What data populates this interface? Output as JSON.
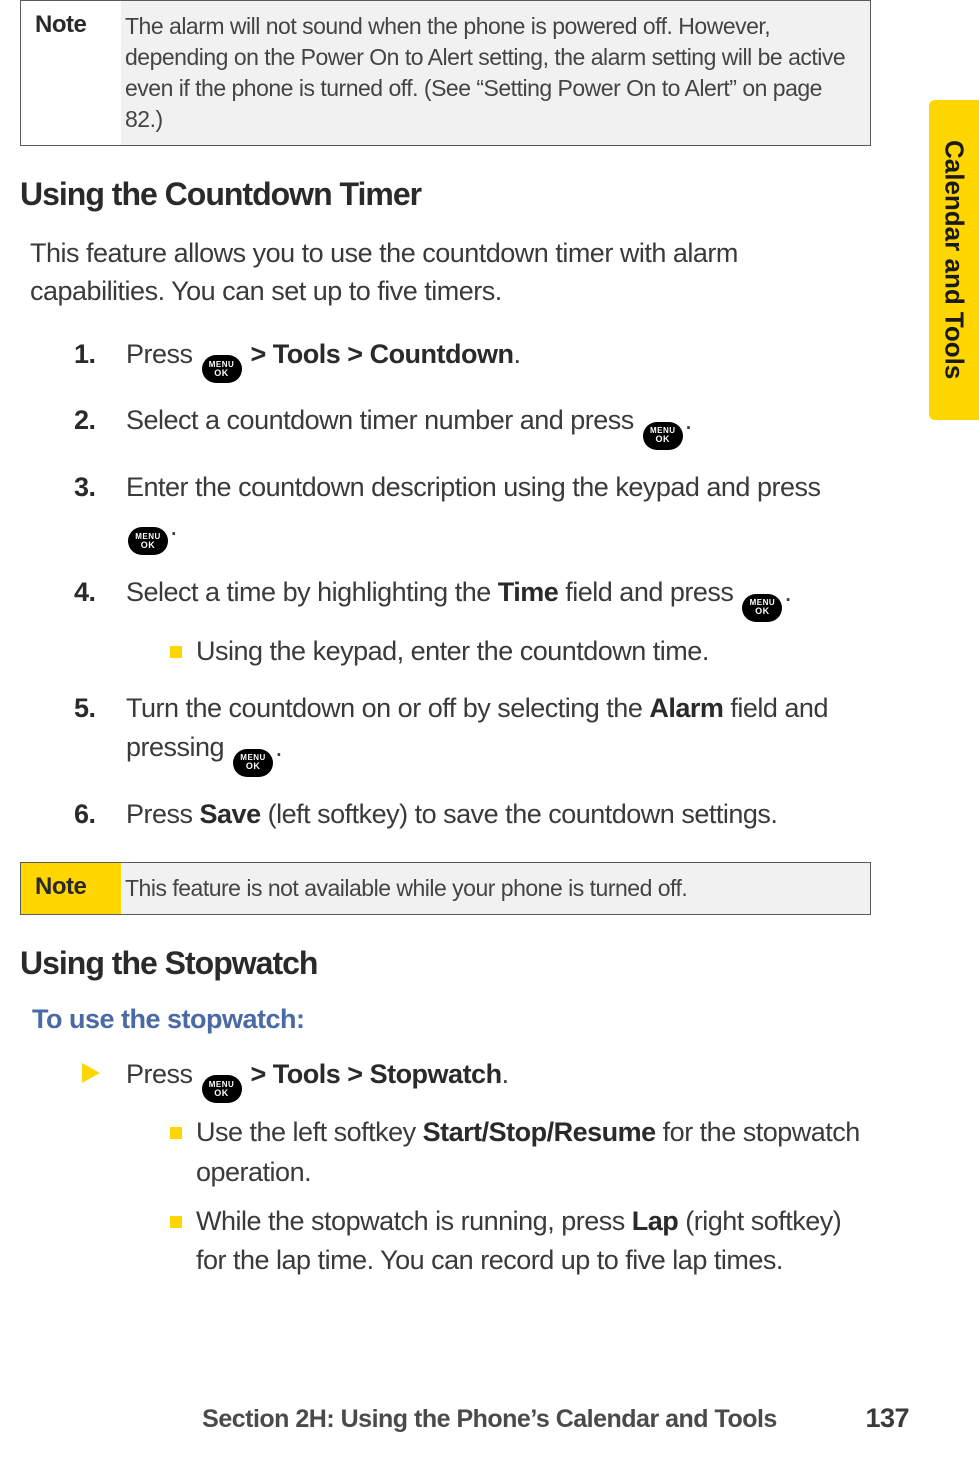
{
  "sideTab": {
    "label": "Calendar and Tools"
  },
  "note1": {
    "label": "Note",
    "body": "The alarm will not sound when the phone is powered off. However, depending on the Power On to Alert setting, the alarm setting will be active even if the phone is turned off. (See “Setting Power On to Alert” on page 82.)"
  },
  "section1": {
    "heading": "Using the Countdown Timer",
    "intro": "This feature allows you to use the countdown timer with alarm capabilities. You can set up to five timers.",
    "steps": {
      "s1_a": "Press ",
      "s1_b": " > Tools > Countdown",
      "s1_c": ".",
      "s2_a": "Select a countdown timer number and press ",
      "s2_b": ".",
      "s3_a": "Enter the countdown description using the keypad and press ",
      "s3_b": ".",
      "s4_a": "Select a time by highlighting the ",
      "s4_time": "Time",
      "s4_b": " field and press ",
      "s4_c": ".",
      "s4_sub": "Using the keypad, enter the countdown time.",
      "s5_a": "Turn the countdown on or off by selecting the ",
      "s5_alarm": "Alarm",
      "s5_b": " field and pressing ",
      "s5_c": ".",
      "s6_a": "Press ",
      "s6_save": "Save",
      "s6_b": " (left softkey) to save the countdown settings."
    }
  },
  "note2": {
    "label": "Note",
    "body": "This feature is not available while your phone is turned off."
  },
  "section2": {
    "heading": "Using the Stopwatch",
    "subInstruction": "To use the stopwatch:",
    "arrow": {
      "a": "Press ",
      "b": " > Tools > Stopwatch",
      "c": "."
    },
    "sub1_a": "Use the left softkey ",
    "sub1_bold": "Start/Stop/Resume",
    "sub1_b": " for the stopwatch operation.",
    "sub2_a": "While the stopwatch is running, press ",
    "sub2_bold": "Lap",
    "sub2_b": " (right softkey) for the lap time. You can record up to five lap times."
  },
  "footer": {
    "text": "Section 2H: Using the Phone’s Calendar and Tools",
    "page": "137"
  },
  "icon": {
    "top": "MENU",
    "bottom": "OK"
  }
}
